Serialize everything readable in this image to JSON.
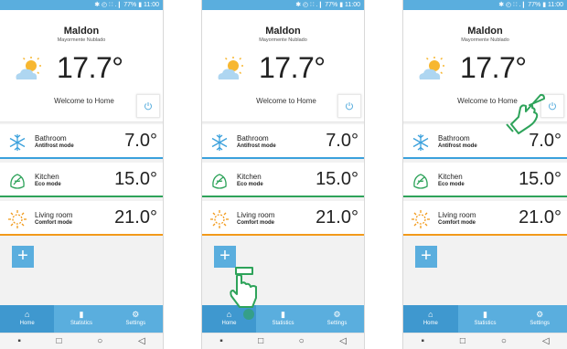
{
  "status": "✱ ◴ ∷ .❙ 77% ▮ 11:00",
  "weather": {
    "city": "Maldon",
    "condition": "Mayormente Nublado",
    "temperature": "17.7°"
  },
  "welcome": "Welcome to Home",
  "rooms": [
    {
      "name": "Bathroom",
      "mode": "Antifrost mode",
      "temp": "7.0°",
      "icon": "snowflake-icon",
      "color": "#3aa0dc"
    },
    {
      "name": "Kitchen",
      "mode": "Eco mode",
      "temp": "15.0°",
      "icon": "eco-leaf-icon",
      "color": "#2ea35a"
    },
    {
      "name": "Living room",
      "mode": "Comfort mode",
      "temp": "21.0°",
      "icon": "sun-icon",
      "color": "#f29a1a"
    }
  ],
  "add_label": "+",
  "tabs": [
    {
      "label": "Home",
      "icon": "home-icon"
    },
    {
      "label": "Statistics",
      "icon": "statistics-icon"
    },
    {
      "label": "Settings",
      "icon": "gear-icon"
    }
  ],
  "navbar": {
    "recent": "▪",
    "home": "□",
    "circle": "○",
    "back": "◁"
  },
  "colors": {
    "accent": "#5aaede",
    "hand": "#2ea35a"
  }
}
